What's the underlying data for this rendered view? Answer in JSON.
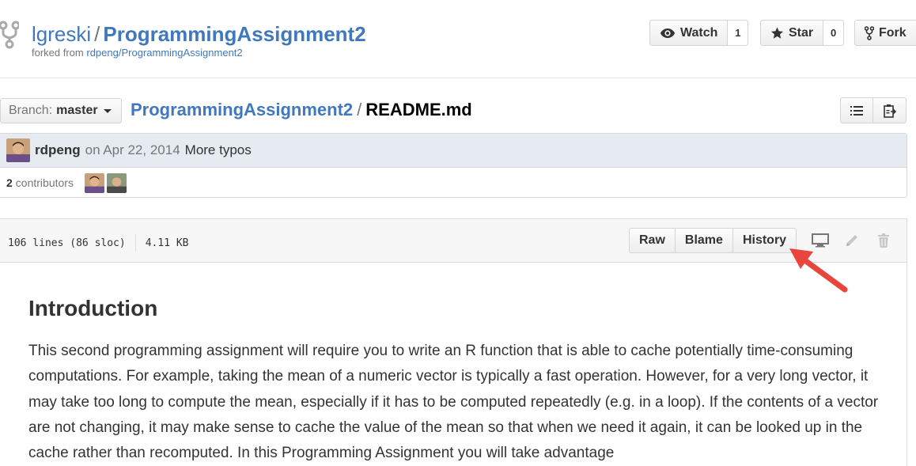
{
  "repo": {
    "owner": "lgreski",
    "separator": "/",
    "name": "ProgrammingAssignment2",
    "forked_prefix": "forked from",
    "forked_from": "rdpeng/ProgrammingAssignment2"
  },
  "social": {
    "watch_label": "Watch",
    "watch_count": "1",
    "star_label": "Star",
    "star_count": "0",
    "fork_label": "Fork"
  },
  "branch": {
    "label": "Branch:",
    "value": "master"
  },
  "breadcrumb": {
    "root": "ProgrammingAssignment2",
    "separator": "/",
    "file": "README.md"
  },
  "commit": {
    "author": "rdpeng",
    "date": "on Apr 22, 2014",
    "message": "More typos",
    "contributors_count": "2",
    "contributors_label": "contributors"
  },
  "file": {
    "lines": "106 lines (86 sloc)",
    "size": "4.11 KB",
    "actions": [
      "Raw",
      "Blame",
      "History"
    ],
    "icons": [
      "desktop-icon",
      "pencil-icon",
      "trash-icon"
    ]
  },
  "readme": {
    "heading": "Introduction",
    "paragraph": "This second programming assignment will require you to write an R function that is able to cache potentially time-consuming computations. For example, taking the mean of a numeric vector is typically a fast operation. However, for a very long vector, it may take too long to compute the mean, especially if it has to be computed repeatedly (e.g. in a loop). If the contents of a vector are not changing, it may make sense to cache the value of the mean so that when we need it again, it can be looked up in the cache rather than recomputed. In this Programming Assignment you will take advantage"
  },
  "colors": {
    "link": "#4078c0",
    "commit_bar": "#e6ebf1",
    "annotation_arrow": "#e8453c"
  }
}
